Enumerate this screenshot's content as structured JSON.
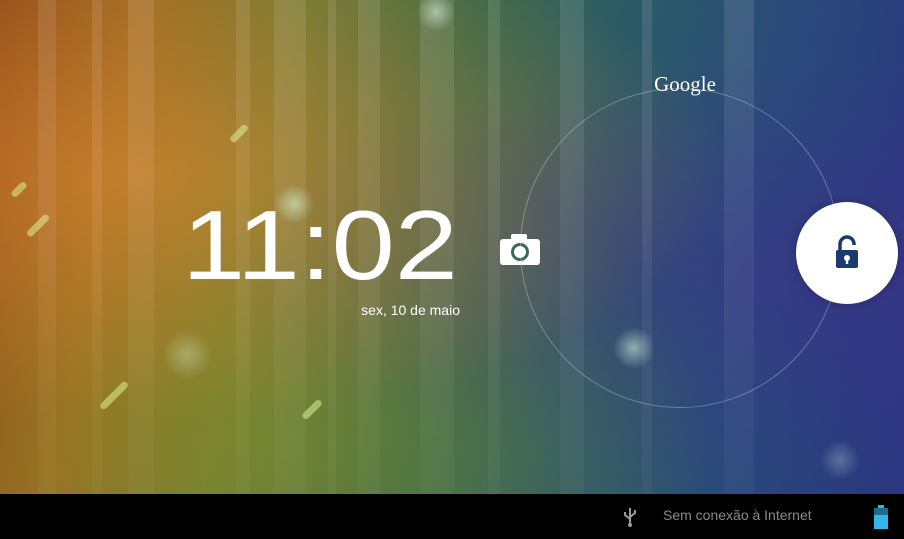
{
  "lockscreen": {
    "time": "11:02",
    "date": "sex, 10 de maio",
    "targets": {
      "top_label": "Google",
      "right_icon": "unlock-icon",
      "left_icon": "camera-icon"
    }
  },
  "status_bar": {
    "usb_icon": "usb-icon",
    "network_status": "Sem conexão à Internet",
    "battery_icon": "battery-icon"
  },
  "colors": {
    "handle_background": "#ffffff",
    "handle_icon": "#1b3a6e",
    "battery_fill": "#33b5e5",
    "status_text": "#8a8a8a"
  }
}
